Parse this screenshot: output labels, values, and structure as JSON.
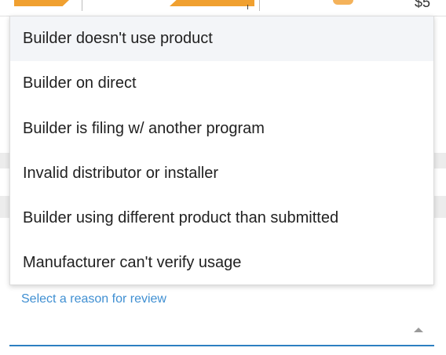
{
  "background_table": {
    "price_fragment": "$5"
  },
  "dropdown": {
    "options": [
      "Builder doesn't use product",
      "Builder on direct",
      "Builder is filing w/ another program",
      "Invalid distributor or installer",
      "Builder using different product than submitted",
      "Manufacturer can't verify usage"
    ]
  },
  "select_field": {
    "label": "Select a reason for review",
    "arrow_icon": "caret-up-icon"
  },
  "colors": {
    "accent": "#2d7fc1",
    "label": "#3f8fd2",
    "highlight": "#f3f5f8",
    "brand_orange": "#f0a030"
  }
}
